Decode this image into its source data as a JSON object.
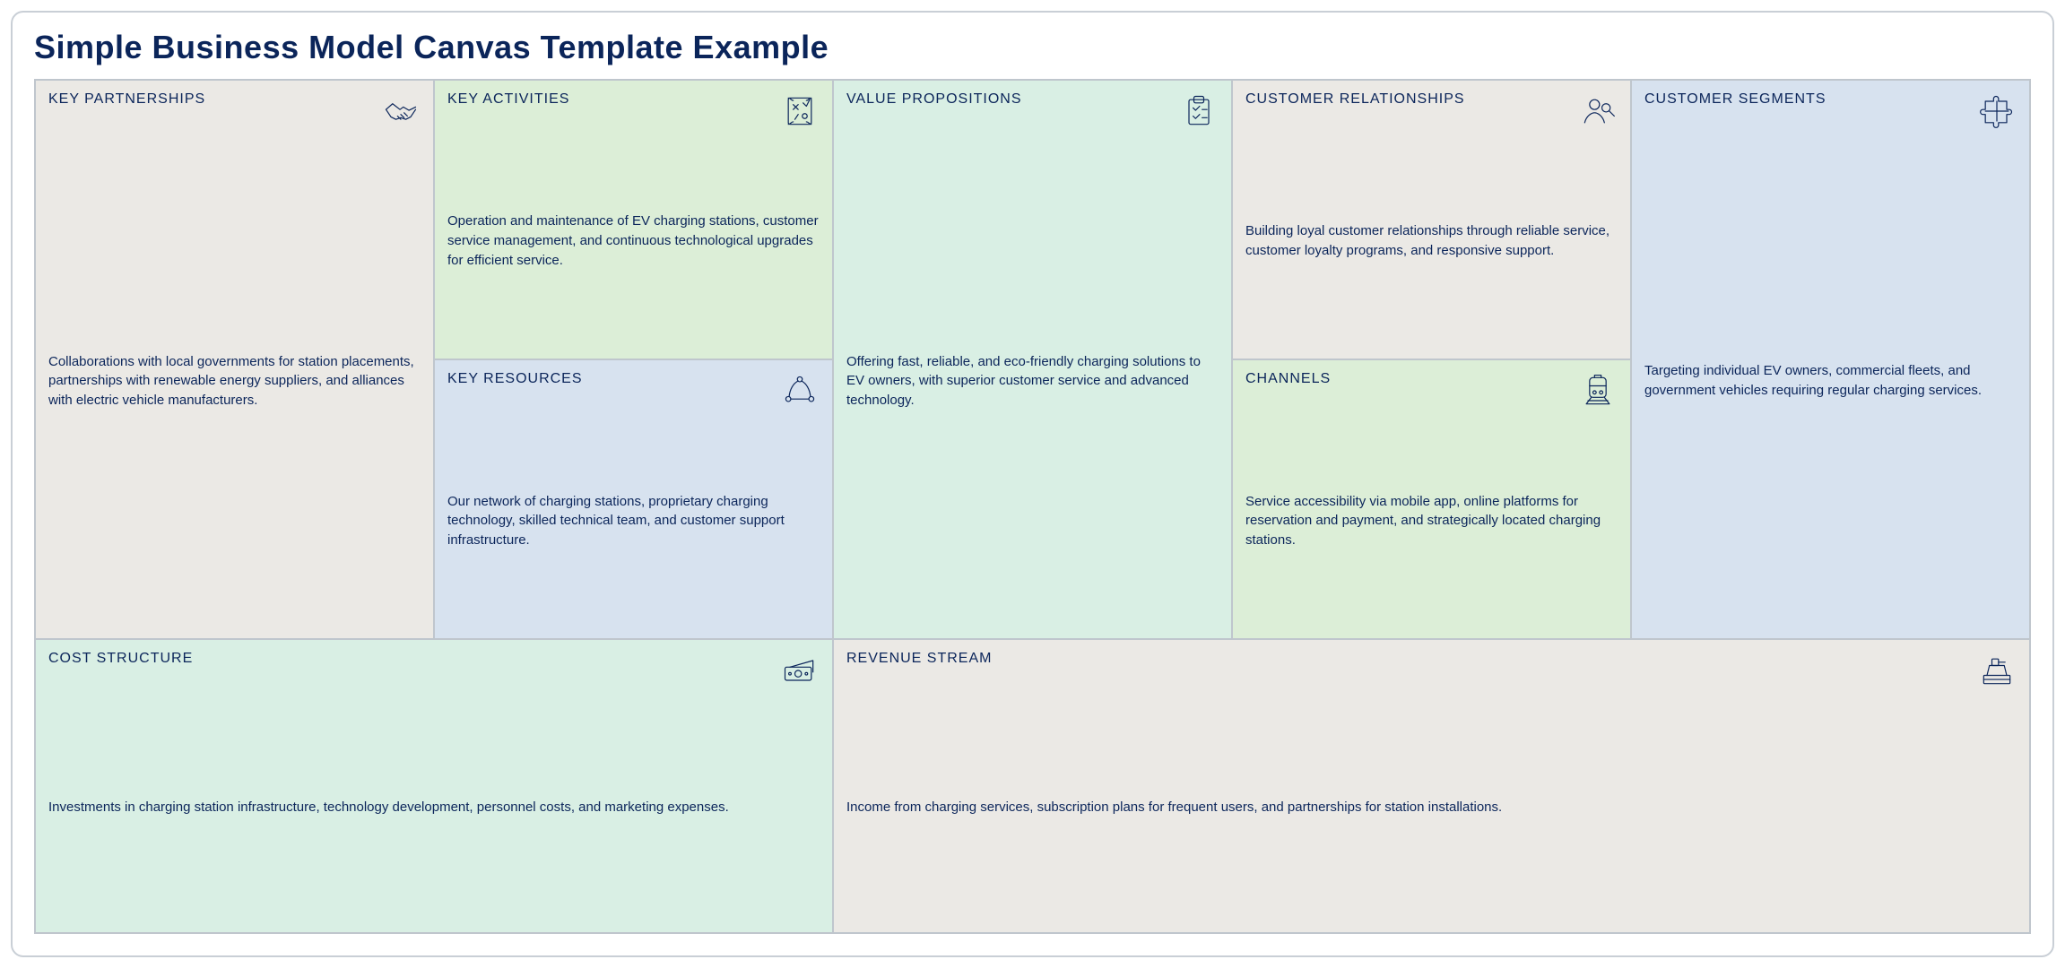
{
  "title": "Simple Business Model Canvas Template Example",
  "cells": {
    "key_partnerships": {
      "label": "KEY PARTNERSHIPS",
      "body": "Collaborations with local governments for station placements, partnerships with renewable energy suppliers, and alliances with electric vehicle manufacturers."
    },
    "key_activities": {
      "label": "KEY ACTIVITIES",
      "body": "Operation and maintenance of EV charging stations, customer service management, and continuous technological upgrades for efficient service."
    },
    "key_resources": {
      "label": "KEY RESOURCES",
      "body": "Our network of charging stations, proprietary charging technology, skilled technical team, and customer support infrastructure."
    },
    "value_propositions": {
      "label": "VALUE PROPOSITIONS",
      "body": "Offering fast, reliable, and eco-friendly charging solutions to EV owners, with superior customer service and advanced technology."
    },
    "customer_relationships": {
      "label": "CUSTOMER RELATIONSHIPS",
      "body": "Building loyal customer relationships through reliable service, customer loyalty programs, and responsive support."
    },
    "channels": {
      "label": "CHANNELS",
      "body": "Service accessibility via mobile app, online platforms for reservation and payment, and strategically located charging stations."
    },
    "customer_segments": {
      "label": "CUSTOMER SEGMENTS",
      "body": "Targeting individual EV owners, commercial fleets, and government vehicles requiring regular charging services."
    },
    "cost_structure": {
      "label": "COST STRUCTURE",
      "body": "Investments in charging station infrastructure, technology development, personnel costs, and marketing expenses."
    },
    "revenue_stream": {
      "label": "REVENUE STREAM",
      "body": "Income from charging services, subscription plans for frequent users, and partnerships for station installations."
    }
  }
}
